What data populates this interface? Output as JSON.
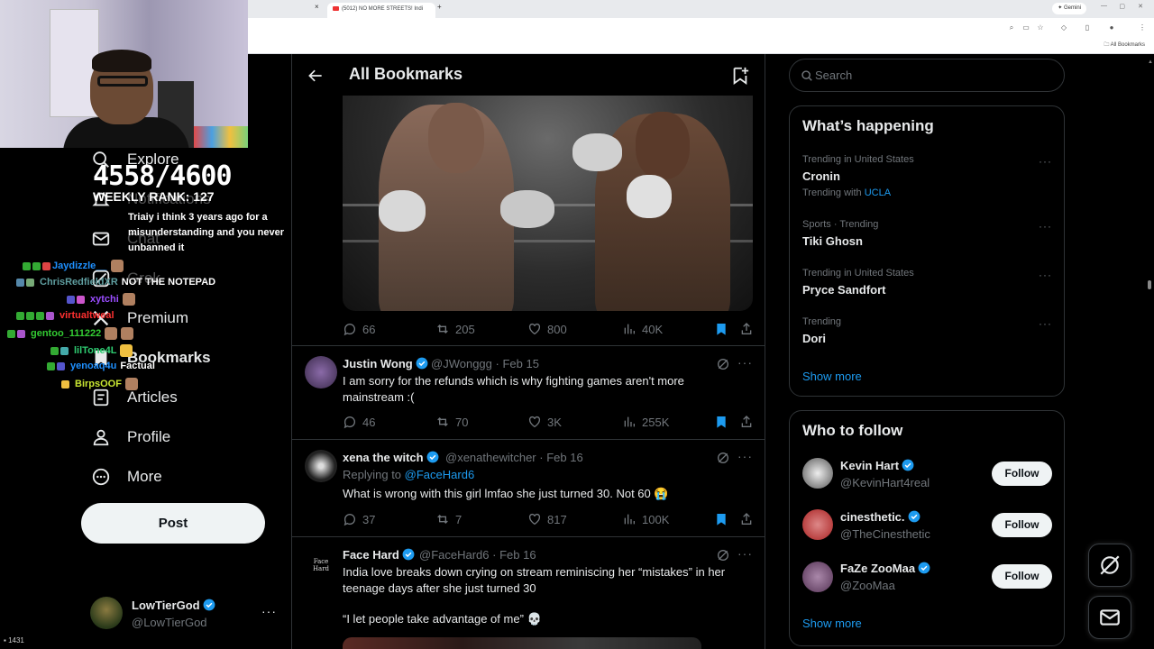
{
  "browser": {
    "tab_prev_close": "×",
    "tab_active_title": "(5012) NO MORE STREETS! Indi",
    "tab_new": "+",
    "gemini_label": "✦ Gemini",
    "bookmarks_folder": "All Bookmarks"
  },
  "overlay": {
    "counter": "4558/4600",
    "weekly_rank": "WEEKLY RANK: 127",
    "viewer_count": "1431",
    "chat": [
      {
        "user": "",
        "message": "Triaiy i think 3 years ago for a misunderstanding and you never unbanned it",
        "color": "#ffffff"
      },
      {
        "user": "Jaydizzle__",
        "message": "",
        "color": "#1e90ff"
      },
      {
        "user": "ChrisRedfieldXR",
        "message": "NOT THE NOTEPAD",
        "color": "#5f9ea0"
      },
      {
        "user": "xytchi",
        "message": "",
        "color": "#9a4dff"
      },
      {
        "user": "virtualtweal",
        "message": "",
        "color": "#ff3030"
      },
      {
        "user": "gentoo_111222",
        "message": "",
        "color": "#33cc33"
      },
      {
        "user": "lilTone4L",
        "message": "",
        "color": "#2ecc71"
      },
      {
        "user": "yenoaq4u",
        "message": "Factual",
        "color": "#1e90ff"
      },
      {
        "user": "BirpsOOF",
        "message": "",
        "color": "#c8e632"
      }
    ]
  },
  "nav": {
    "explore": "Explore",
    "notifications": "Notifications",
    "chat": "Chat",
    "grok": "Grok",
    "premium": "Premium",
    "bookmarks": "Bookmarks",
    "articles": "Articles",
    "profile": "Profile",
    "more": "More",
    "post_button": "Post"
  },
  "account": {
    "name": "LowTierGod",
    "handle": "@LowTierGod",
    "more": "···"
  },
  "timeline": {
    "title": "All Bookmarks",
    "media_post": {
      "replies": "66",
      "reposts": "205",
      "likes": "800",
      "views": "40K"
    },
    "tweets": [
      {
        "name": "Justin Wong",
        "handle": "@JWonggg",
        "date": "Feb 15",
        "replying_to": "",
        "text": "I am sorry for the refunds which is why fighting games aren't more mainstream :(",
        "replies": "46",
        "reposts": "70",
        "likes": "3K",
        "views": "255K"
      },
      {
        "name": "xena the witch",
        "handle": "@xenathewitcher",
        "date": "Feb 16",
        "replying_label": "Replying to",
        "replying_to": "@FaceHard6",
        "text": "What is wrong with this girl lmfao she just turned 30. Not 60 😭",
        "replies": "37",
        "reposts": "7",
        "likes": "817",
        "views": "100K"
      },
      {
        "name": "Face Hard",
        "handle": "@FaceHard6",
        "date": "Feb 16",
        "avatar_text": "Face Hard",
        "text": "India love breaks down crying on stream reminiscing her “mistakes” in her teenage days after she just turned 30",
        "quote": "“I let people take advantage of me” 💀"
      }
    ]
  },
  "search": {
    "placeholder": "Search"
  },
  "trends": {
    "title": "What’s happening",
    "items": [
      {
        "context": "Trending in United States",
        "name": "Cronin",
        "with_label": "Trending with",
        "with": "UCLA"
      },
      {
        "context": "Sports · Trending",
        "name": "Tiki Ghosn"
      },
      {
        "context": "Trending in United States",
        "name": "Pryce Sandfort"
      },
      {
        "context": "Trending",
        "name": "Dori"
      }
    ],
    "show_more": "Show more",
    "more": "···"
  },
  "who_to_follow": {
    "title": "Who to follow",
    "items": [
      {
        "name": "Kevin Hart",
        "handle": "@KevinHart4real",
        "button": "Follow"
      },
      {
        "name": "cinesthetic.",
        "handle": "@TheCinesthetic",
        "button": "Follow"
      },
      {
        "name": "FaZe ZooMaa",
        "handle": "@ZooMaa",
        "button": "Follow"
      }
    ],
    "show_more": "Show more"
  },
  "colors": {
    "accent": "#1d9bf0",
    "background": "#000000",
    "border": "#2f3336",
    "muted": "#71767b"
  }
}
